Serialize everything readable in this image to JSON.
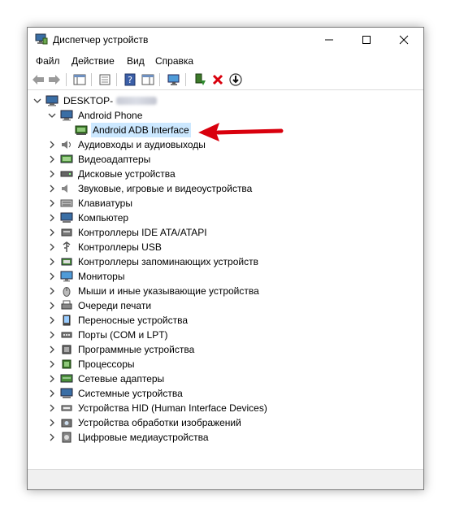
{
  "window": {
    "title": "Диспетчер устройств"
  },
  "menu": {
    "file": "Файл",
    "action": "Действие",
    "view": "Вид",
    "help": "Справка"
  },
  "tree": {
    "computer": "DESKTOP-",
    "android_group": "Android Phone",
    "adb": "Android ADB Interface",
    "categories": [
      "Аудиовходы и аудиовыходы",
      "Видеоадаптеры",
      "Дисковые устройства",
      "Звуковые, игровые и видеоустройства",
      "Клавиатуры",
      "Компьютер",
      "Контроллеры IDE ATA/ATAPI",
      "Контроллеры USB",
      "Контроллеры запоминающих устройств",
      "Мониторы",
      "Мыши и иные указывающие устройства",
      "Очереди печати",
      "Переносные устройства",
      "Порты (COM и LPT)",
      "Программные устройства",
      "Процессоры",
      "Сетевые адаптеры",
      "Системные устройства",
      "Устройства HID (Human Interface Devices)",
      "Устройства обработки изображений",
      "Цифровые медиаустройства"
    ]
  },
  "colors": {
    "selection": "#cce8ff",
    "annotation_arrow": "#d9000d",
    "remove_icon": "#d9000d"
  }
}
